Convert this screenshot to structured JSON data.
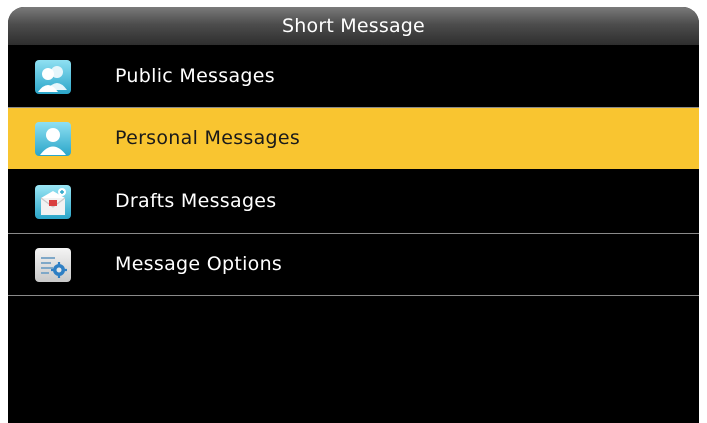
{
  "window": {
    "title": "Short Message"
  },
  "menu": {
    "items": [
      {
        "label": "Public Messages",
        "icon": "public-messages-icon",
        "selected": false
      },
      {
        "label": "Personal Messages",
        "icon": "personal-messages-icon",
        "selected": true
      },
      {
        "label": "Drafts Messages",
        "icon": "drafts-messages-icon",
        "selected": false
      },
      {
        "label": "Message Options",
        "icon": "message-options-icon",
        "selected": false
      }
    ]
  },
  "colors": {
    "selected_background": "#f9c530",
    "screen_background": "#000000",
    "title_bar": "#4d4d4d"
  }
}
